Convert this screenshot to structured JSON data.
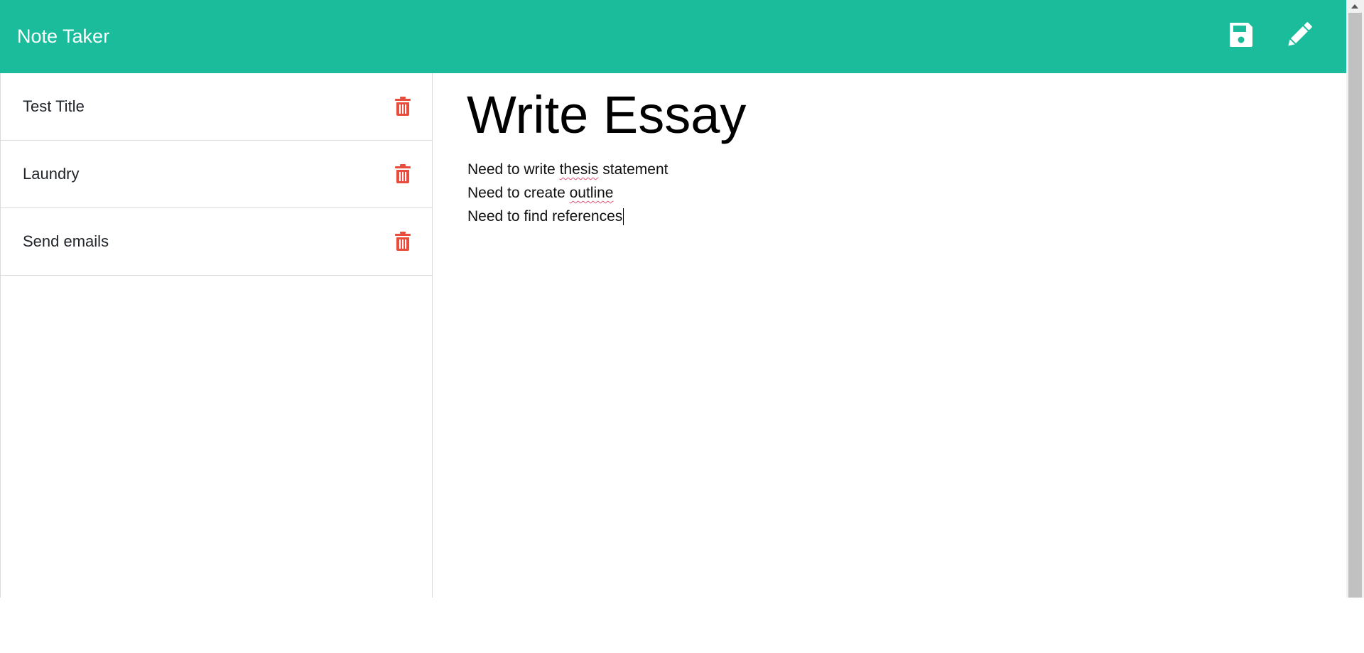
{
  "app": {
    "title": "Note Taker",
    "accent_color": "#1abc9c",
    "delete_color": "#e74c3c"
  },
  "toolbar": {
    "save_icon": "save-icon",
    "edit_icon": "edit-icon"
  },
  "notes": [
    {
      "title": "Test Title",
      "icon": "trash-icon"
    },
    {
      "title": "Laundry",
      "icon": "trash-icon"
    },
    {
      "title": "Send emails",
      "icon": "trash-icon"
    }
  ],
  "active_note": {
    "title": "Write Essay",
    "lines": [
      {
        "before": "Need to write ",
        "misspelled": "thesis",
        "after": " statement"
      },
      {
        "before": "Need to create ",
        "misspelled": "outline",
        "after": ""
      },
      {
        "before": "Need to find references",
        "misspelled": "",
        "after": ""
      }
    ]
  }
}
